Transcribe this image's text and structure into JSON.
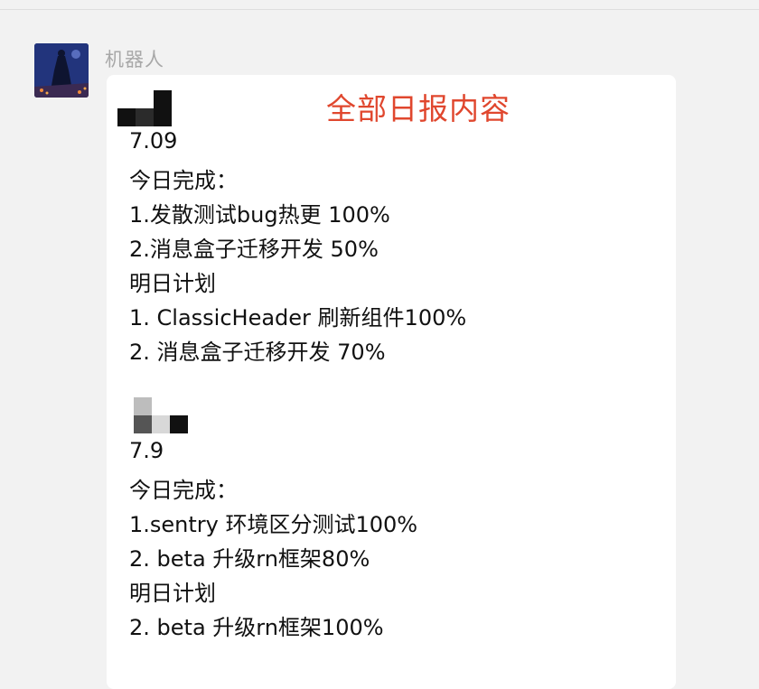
{
  "sender": {
    "name": "机器人"
  },
  "annotation": {
    "text": "全部日报内容",
    "color": "#e0472e"
  },
  "reports": [
    {
      "lines": [
        "7.09",
        "今日完成：",
        "1.发散测试bug热更 100%",
        "2.消息盒子迁移开发 50%",
        "明日计划",
        "1. ClassicHeader 刷新组件100%",
        "2. 消息盒子迁移开发 70%"
      ]
    },
    {
      "lines": [
        "7.9",
        "今日完成：",
        "1.sentry 环境区分测试100%",
        "2. beta 升级rn框架80%",
        "明日计划",
        "2. beta 升级rn框架100%"
      ]
    }
  ]
}
